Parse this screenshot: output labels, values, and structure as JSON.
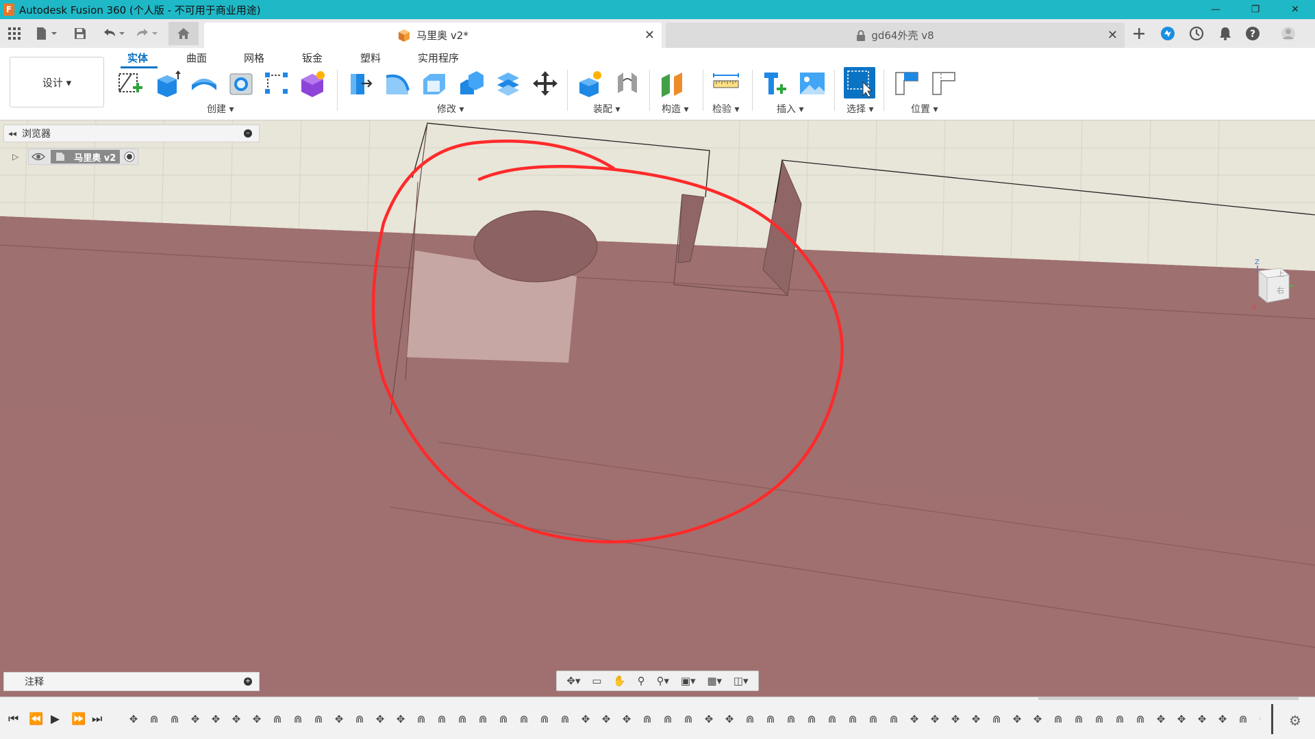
{
  "window": {
    "title": "Autodesk Fusion 360 (个人版 - 不可用于商业用途)",
    "app_icon_letter": "F",
    "minimize": "—",
    "restore": "❐",
    "close": "✕"
  },
  "tabs": {
    "active": {
      "label": "马里奥 v2*",
      "close": "✕"
    },
    "inactive": {
      "label": "gd64外壳 v8",
      "close": "✕"
    }
  },
  "ribbon": {
    "workspace": "设计 ▾",
    "tabs": [
      "实体",
      "曲面",
      "网格",
      "钣金",
      "塑料",
      "实用程序"
    ],
    "groups": {
      "create": "创建 ▾",
      "modify": "修改 ▾",
      "assemble": "装配 ▾",
      "construct": "构造 ▾",
      "inspect": "检验 ▾",
      "insert": "插入 ▾",
      "select": "选择 ▾",
      "position": "位置 ▾"
    }
  },
  "browser": {
    "header": "浏览器",
    "root_item": "马里奥 v2"
  },
  "comments": {
    "header": "注释"
  },
  "colors": {
    "titlebar": "#1fb8c7",
    "accent": "#0b73c4",
    "ground": "#a07070",
    "sketch_mark": "#ff2a2a"
  },
  "viewcube": {
    "axis_z": "Z",
    "axis_x": "X",
    "face_top": "上",
    "face_right": "右"
  },
  "timeline": {
    "item_pattern": [
      "move",
      "joint",
      "joint",
      "move",
      "move",
      "move",
      "move",
      "joint",
      "joint",
      "joint",
      "move",
      "joint",
      "move",
      "move",
      "joint",
      "joint",
      "joint",
      "joint",
      "joint",
      "joint",
      "joint",
      "joint",
      "move",
      "move",
      "move",
      "joint",
      "joint",
      "joint",
      "move",
      "move",
      "joint",
      "joint",
      "joint",
      "joint",
      "joint",
      "joint",
      "joint",
      "joint",
      "move",
      "move",
      "move",
      "move",
      "joint",
      "move",
      "move",
      "joint",
      "joint",
      "joint",
      "joint",
      "joint",
      "move",
      "move",
      "move",
      "move",
      "joint",
      "move",
      "joint",
      "move"
    ]
  }
}
